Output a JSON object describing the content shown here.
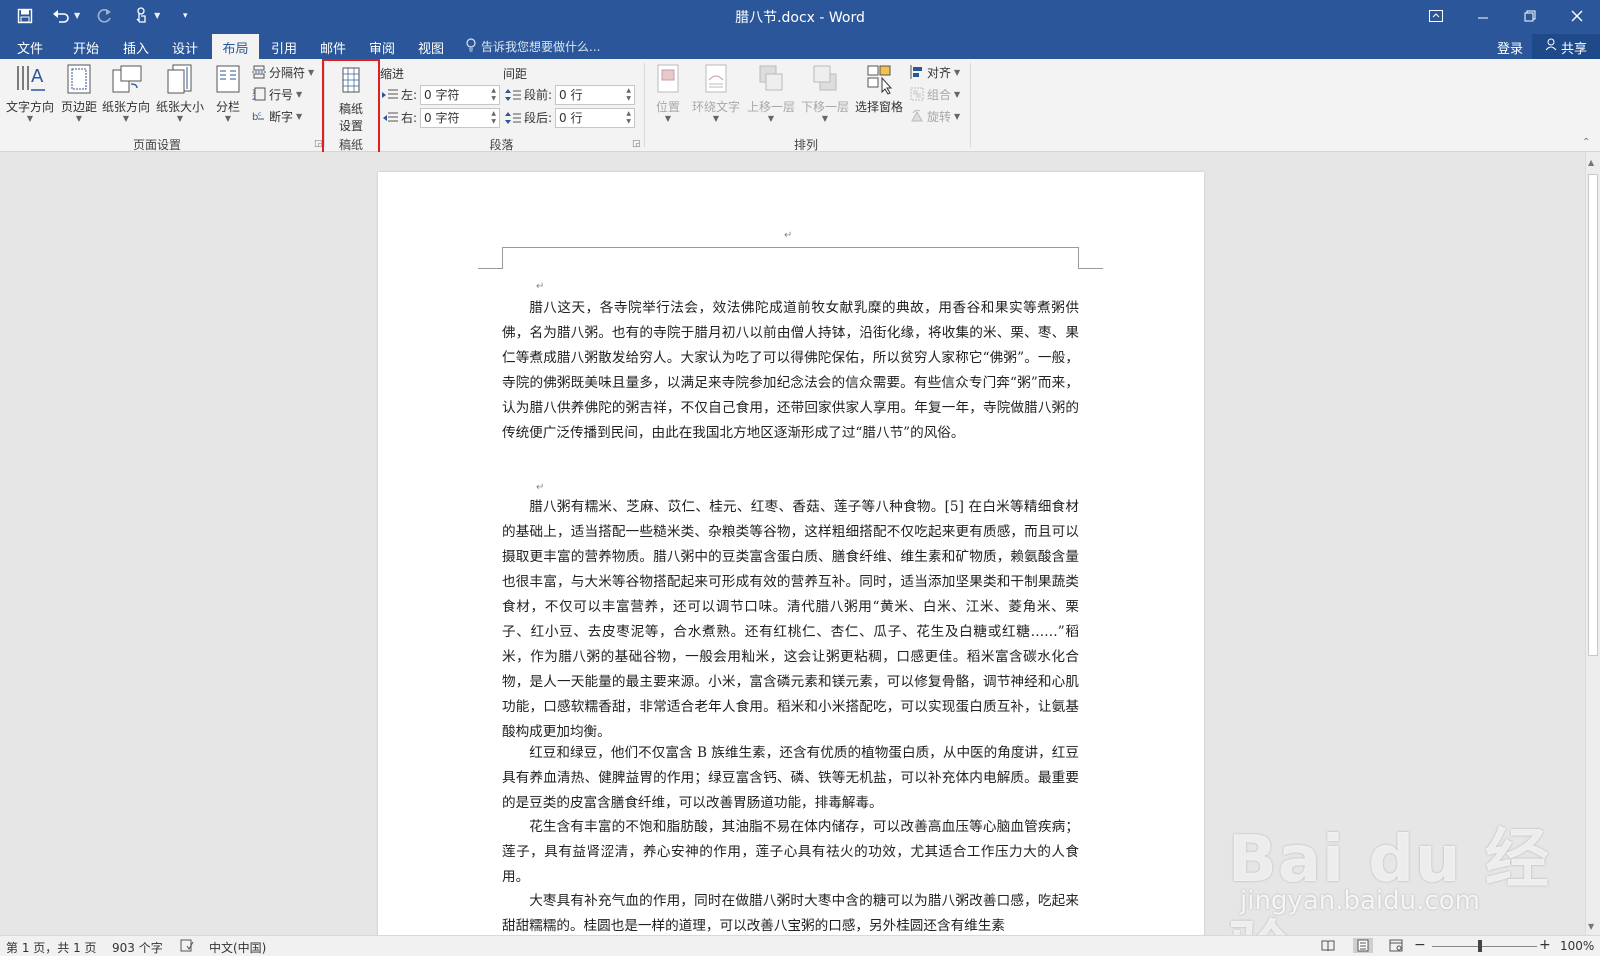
{
  "window": {
    "title": "腊八节.docx - Word"
  },
  "tabs": [
    {
      "label": "文件"
    },
    {
      "label": "开始"
    },
    {
      "label": "插入"
    },
    {
      "label": "设计"
    },
    {
      "label": "布局"
    },
    {
      "label": "引用"
    },
    {
      "label": "邮件"
    },
    {
      "label": "审阅"
    },
    {
      "label": "视图"
    }
  ],
  "active_tab": "布局",
  "tell_me_placeholder": "告诉我您想要做什么...",
  "account": {
    "signin": "登录",
    "share": "共享"
  },
  "ribbon": {
    "page_setup": {
      "label": "页面设置",
      "text_direction": "文字方向",
      "margins": "页边距",
      "orientation": "纸张方向",
      "size": "纸张大小",
      "columns": "分栏",
      "breaks": "分隔符",
      "line_numbers": "行号",
      "hyphenation": "断字"
    },
    "manuscript": {
      "label": "稿纸",
      "settings_line1": "稿纸",
      "settings_line2": "设置"
    },
    "paragraph": {
      "label": "段落",
      "indent_label": "缩进",
      "spacing_label": "间距",
      "indent_left_label": "左:",
      "indent_left_value": "0 字符",
      "indent_right_label": "右:",
      "indent_right_value": "0 字符",
      "spacing_before_label": "段前:",
      "spacing_before_value": "0 行",
      "spacing_after_label": "段后:",
      "spacing_after_value": "0 行"
    },
    "arrange": {
      "label": "排列",
      "position": "位置",
      "wrap_text": "环绕文字",
      "bring_forward": "上移一层",
      "send_backward": "下移一层",
      "selection_pane": "选择窗格",
      "align": "对齐",
      "group": "组合",
      "rotate": "旋转"
    }
  },
  "document": {
    "paragraphs": [
      "腊八这天，各寺院举行法会，效法佛陀成道前牧女献乳糜的典故，用香谷和果实等煮粥供佛，名为腊八粥。也有的寺院于腊月初八以前由僧人持钵，沿街化缘，将收集的米、栗、枣、果仁等煮成腊八粥散发给穷人。大家认为吃了可以得佛陀保佑，所以贫穷人家称它“佛粥”。一般，寺院的佛粥既美味且量多，以满足来寺院参加纪念法会的信众需要。有些信众专门奔“粥”而来，认为腊八供养佛陀的粥吉祥，不仅自己食用，还带回家供家人享用。年复一年，寺院做腊八粥的传统便广泛传播到民间，由此在我国北方地区逐渐形成了过“腊八节”的风俗。",
      "腊八粥有糯米、芝麻、苡仁、桂元、红枣、香菇、莲子等八种食物。[5] 在白米等精细食材的基础上，适当搭配一些糙米类、杂粮类等谷物，这样粗细搭配不仅吃起来更有质感，而且可以摄取更丰富的营养物质。腊八粥中的豆类富含蛋白质、膳食纤维、维生素和矿物质，赖氨酸含量也很丰富，与大米等谷物搭配起来可形成有效的营养互补。同时，适当添加坚果类和干制果蔬类食材，不仅可以丰富营养，还可以调节口味。清代腊八粥用“黄米、白米、江米、菱角米、栗子、红小豆、去皮枣泥等，合水煮熟。还有红桃仁、杏仁、瓜子、花生及白糖或红糖……”稻米，作为腊八粥的基础谷物，一般会用籼米，这会让粥更粘稠，口感更佳。稻米富含碳水化合物，是人一天能量的最主要来源。小米，富含磷元素和镁元素，可以修复骨骼，调节神经和心肌功能，口感软糯香甜，非常适合老年人食用。稻米和小米搭配吃，可以实现蛋白质互补，让氨基酸构成更加均衡。",
      "红豆和绿豆，他们不仅富含 B 族维生素，还含有优质的植物蛋白质，从中医的角度讲，红豆具有养血清热、健脾益胃的作用；绿豆富含钙、磷、铁等无机盐，可以补充体内电解质。最重要的是豆类的皮富含膳食纤维，可以改善胃肠道功能，排毒解毒。",
      "花生含有丰富的不饱和脂肪酸，其油脂不易在体内储存，可以改善高血压等心脑血管疾病；莲子，具有益肾涩清，养心安神的作用，莲子心具有祛火的功效，尤其适合工作压力大的人食用。",
      "大枣具有补充气血的作用，同时在做腊八粥时大枣中含的糖可以为腊八粥改善口感，吃起来甜甜糯糯的。桂圆也是一样的道理，可以改善八宝粥的口感，另外桂圆还含有维生素"
    ]
  },
  "status": {
    "page": "第 1 页，共 1 页",
    "words": "903 个字",
    "language": "中文(中国)",
    "zoom": "100%",
    "zoom_minus": "−",
    "zoom_plus": "+"
  },
  "watermark": {
    "brand": "Bai du 经验",
    "url": "jingyan.baidu.com"
  },
  "colors": {
    "titlebar": "#2b579a",
    "ribbon": "#f3f3f3",
    "highlight": "#e02020",
    "canvas": "#e6e6e6"
  }
}
